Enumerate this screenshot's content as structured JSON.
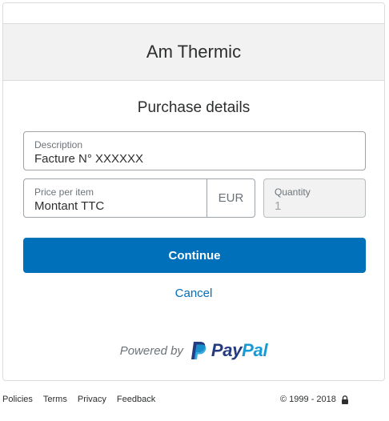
{
  "merchant": {
    "name": "Am Thermic"
  },
  "section": {
    "title": "Purchase details"
  },
  "form": {
    "description": {
      "label": "Description",
      "value": "Facture N° XXXXXX"
    },
    "price": {
      "label": "Price per item",
      "value": "Montant TTC",
      "currency": "EUR"
    },
    "quantity": {
      "label": "Quantity",
      "value": "1"
    }
  },
  "actions": {
    "continue_label": "Continue",
    "cancel_label": "Cancel"
  },
  "powered": {
    "text": "Powered by",
    "logo_pay": "Pay",
    "logo_pal": "Pal"
  },
  "footer": {
    "links": [
      "Policies",
      "Terms",
      "Privacy",
      "Feedback"
    ],
    "copyright": "© 1999 - 2018"
  },
  "colors": {
    "primary": "#0070ba",
    "paypal_dark": "#253b80",
    "paypal_light": "#179bd7",
    "header_bg": "#f2f2f2"
  },
  "icons": {
    "logo": "paypal-p-icon",
    "lock": "lock-icon"
  }
}
